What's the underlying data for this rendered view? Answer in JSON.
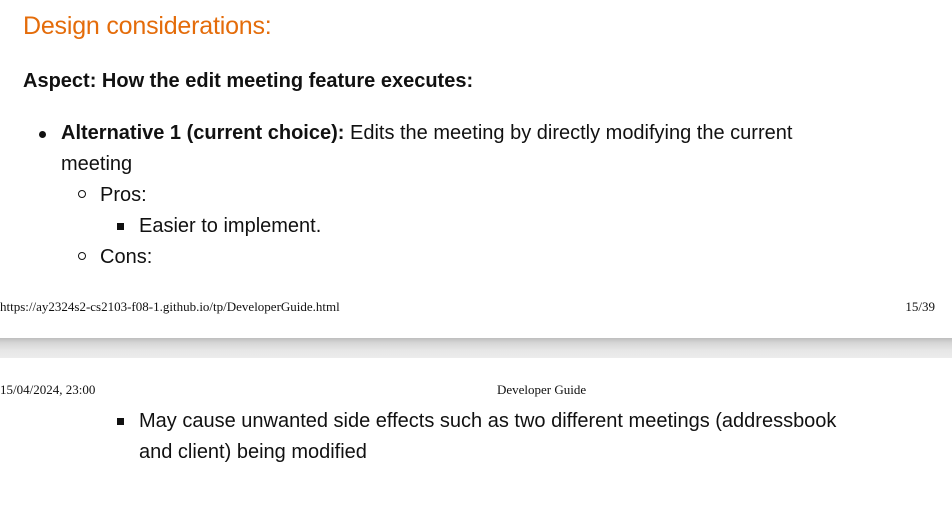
{
  "page1": {
    "section_heading": "Design considerations:",
    "aspect": "Aspect: How the edit meeting feature executes:",
    "alternative": {
      "label": "Alternative 1 (current choice):",
      "text_line1": " Edits the meeting by directly modifying the current",
      "text_line2": "meeting"
    },
    "pros_label": "Pros:",
    "pros_items": [
      "Easier to implement."
    ],
    "cons_label": "Cons:",
    "footer_url": "https://ay2324s2-cs2103-f08-1.github.io/tp/DeveloperGuide.html",
    "footer_page": "15/39"
  },
  "page2": {
    "header_date": "15/04/2024, 23:00",
    "header_title": "Developer Guide",
    "cons_items": [
      {
        "line1": "May cause unwanted side effects such as two different meetings (addressbook",
        "line2": "and client) being modified"
      }
    ]
  },
  "colors": {
    "heading": "#e46c0a",
    "text": "#111111",
    "page_gap": "#d6d6d6"
  }
}
